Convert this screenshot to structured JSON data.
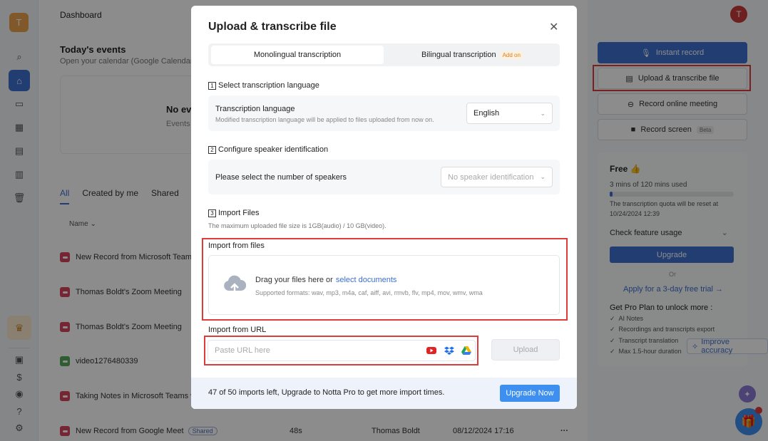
{
  "rail": {
    "avatar_letter": "T",
    "icons": [
      "search-icon",
      "home-icon",
      "folder-icon",
      "calendar-icon",
      "calendar-check-icon",
      "notes-icon",
      "trash-icon",
      "crown-icon",
      "briefcase-icon",
      "dollar-icon",
      "location-icon",
      "help-icon",
      "settings-icon"
    ]
  },
  "header": {
    "title": "Dashboard",
    "user_initial": "T"
  },
  "events": {
    "title": "Today's events",
    "subtitle": "Open your calendar (Google Calendar o",
    "empty_title": "No eve",
    "empty_sub": "Events c"
  },
  "list": {
    "tabs": [
      "All",
      "Created by me",
      "Shared"
    ],
    "name_header": "Name",
    "rows": [
      {
        "title": "New Record from Microsoft Team",
        "kind": "record"
      },
      {
        "title": "Thomas Boldt's Zoom Meeting",
        "kind": "record"
      },
      {
        "title": "Thomas Boldt's Zoom Meeting",
        "kind": "record"
      },
      {
        "title": "video1276480339",
        "kind": "file"
      },
      {
        "title": "Taking Notes in Microsoft Teams wi",
        "kind": "record"
      },
      {
        "title": "New Record from Google Meet",
        "kind": "record",
        "badge": "Shared",
        "duration": "48s",
        "owner": "Thomas Boldt",
        "date": "08/12/2024 17:16",
        "more": "···"
      }
    ]
  },
  "right": {
    "instant_record": "Instant record",
    "upload_transcribe": "Upload & transcribe file",
    "record_online": "Record online meeting",
    "record_screen": "Record screen",
    "beta": "Beta",
    "plan": {
      "name": "Free",
      "usage": "3 mins of 120 mins used",
      "usage_fraction": 0.025,
      "reset_line1": "The transcription quota will be reset at",
      "reset_line2": "10/24/2024 12:39",
      "check_usage": "Check feature usage",
      "upgrade": "Upgrade",
      "or": "Or",
      "trial": "Apply for a 3-day free trial →",
      "pro_title": "Get Pro Plan to unlock more :",
      "features": [
        "AI Notes",
        "Recordings and transcripts export",
        "Transcript translation",
        "Max 1.5-hour duration"
      ]
    },
    "improve": "Improve accuracy"
  },
  "modal": {
    "title": "Upload & transcribe file",
    "tab_mono": "Monolingual transcription",
    "tab_bi": "Bilingual transcription",
    "addon": "Add on",
    "step1": {
      "num": "1",
      "title": "Select transcription language",
      "label": "Transcription language",
      "sub": "Modified transcription language will be applied to files uploaded from now on.",
      "value": "English"
    },
    "step2": {
      "num": "2",
      "title": "Configure speaker identification",
      "label": "Please select the number of speakers",
      "value": "No speaker identification"
    },
    "step3": {
      "num": "3",
      "title": "Import Files",
      "sub": "The maximum uploaded file size is 1GB(audio) / 10 GB(video)."
    },
    "files": {
      "label": "Import from files",
      "drag": "Drag your files here or",
      "select": "select documents",
      "formats": "Supported formats: wav, mp3, m4a, caf, aiff, avi, rmvb, flv, mp4, mov, wmv, wma"
    },
    "url": {
      "label": "Import from URL",
      "placeholder": "Paste URL here",
      "upload": "Upload"
    },
    "footer": {
      "text": "47 of 50 imports left, Upgrade to Notta Pro to get more import times.",
      "button": "Upgrade Now"
    }
  }
}
